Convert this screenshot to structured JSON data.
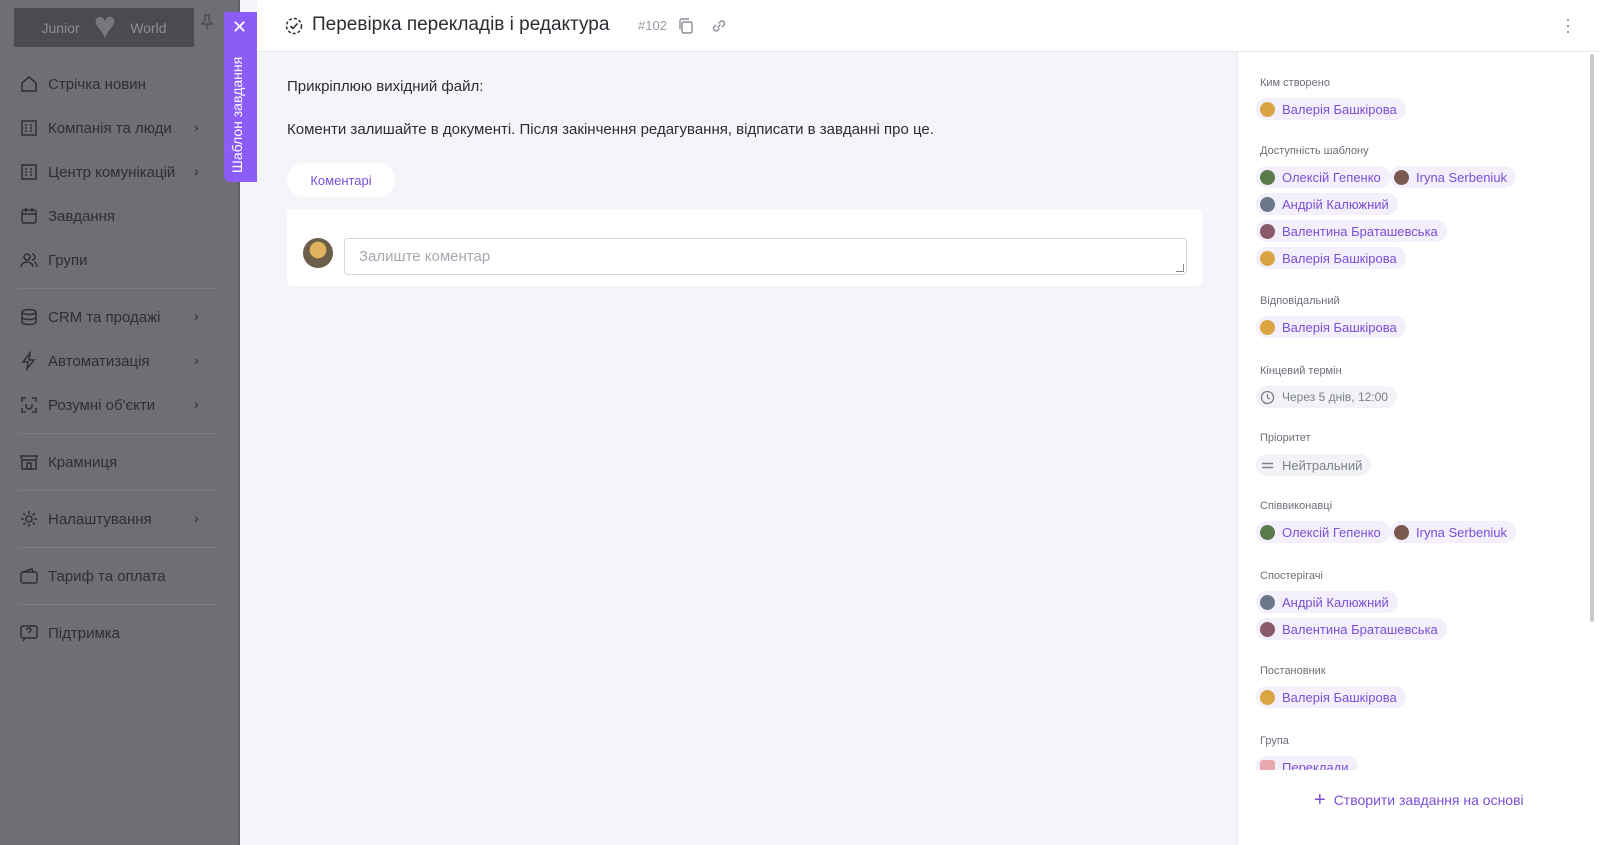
{
  "sidebar": {
    "logo": {
      "left": "Junior",
      "right": "World"
    },
    "items": [
      {
        "label": "Стрічка новин",
        "icon": "home-icon",
        "chevron": false
      },
      {
        "label": "Компанія та люди",
        "icon": "building-icon",
        "chevron": true
      },
      {
        "label": "Центр комунікацій",
        "icon": "building-icon",
        "chevron": true
      },
      {
        "label": "Завдання",
        "icon": "calendar-icon",
        "chevron": false
      },
      {
        "label": "Групи",
        "icon": "users-icon",
        "chevron": false
      },
      {
        "label": "CRM та продажі",
        "icon": "database-icon",
        "chevron": true
      },
      {
        "label": "Автоматизація",
        "icon": "bolt-icon",
        "chevron": true
      },
      {
        "label": "Розумні об'єкти",
        "icon": "scan-icon",
        "chevron": true
      },
      {
        "label": "Крамниця",
        "icon": "store-icon",
        "chevron": false
      },
      {
        "label": "Налаштування",
        "icon": "gear-icon",
        "chevron": true
      },
      {
        "label": "Тариф та оплата",
        "icon": "wallet-icon",
        "chevron": false
      },
      {
        "label": "Підтримка",
        "icon": "help-icon",
        "chevron": false
      }
    ]
  },
  "template_tab": {
    "label": "Шаблон завдання"
  },
  "task": {
    "title": "Перевірка перекладів і редактура",
    "id": "#102",
    "description_line1": "Прикріплюю вихідний файл:",
    "description_line2": "Коменти залишайте в документі. Після закінчення редагування, відписати в завданні про це.",
    "comments_tab": "Коментарі",
    "comment_placeholder": "Залиште коментар"
  },
  "panel": {
    "created_by_label": "Ким створено",
    "created_by": "Валерія Башкірова",
    "availability_label": "Доступність шаблону",
    "availability": [
      "Олексій Гепенко",
      "Iryna Serbeniuk",
      "Андрій Калюжний",
      "Валентина Браташевська",
      "Валерія Башкірова"
    ],
    "responsible_label": "Відповідальний",
    "responsible": "Валерія Башкірова",
    "deadline_label": "Кінцевий термін",
    "deadline": "Через 5 днів, 12:00",
    "priority_label": "Пріоритет",
    "priority": "Нейтральний",
    "coexecutors_label": "Співвиконавці",
    "coexecutors": [
      "Олексій Гепенко",
      "Iryna Serbeniuk"
    ],
    "observers_label": "Спостерігачі",
    "observers": [
      "Андрій Калюжний",
      "Валентина Браташевська"
    ],
    "setter_label": "Постановник",
    "setter": "Валерія Башкірова",
    "group_label": "Група",
    "group": "Переклади",
    "create_based_label": "Створити завдання на основі"
  },
  "colors": {
    "accent": "#8b5cf6",
    "chip_text": "#7b4fd6",
    "chip_bg": "#f3effb"
  }
}
